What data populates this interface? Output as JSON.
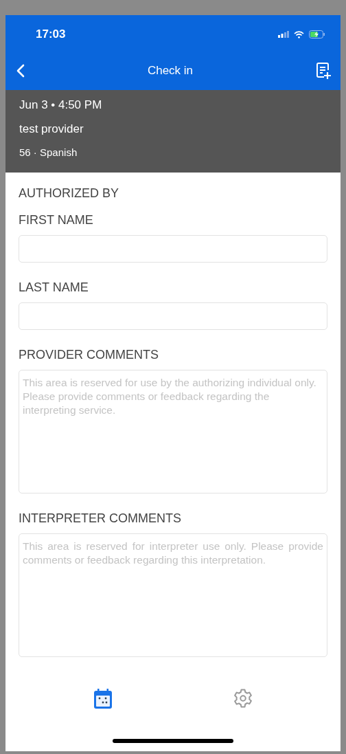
{
  "status_bar": {
    "time": "17:03"
  },
  "nav": {
    "title": "Check in"
  },
  "appointment": {
    "datetime": "Jun 3 • 4:50 PM",
    "provider": "test provider",
    "details": "56 · Spanish"
  },
  "form": {
    "section": "AUTHORIZED BY",
    "fields": [
      {
        "kind": "text",
        "label": "FIRST NAME"
      },
      {
        "kind": "text",
        "label": "LAST NAME"
      },
      {
        "kind": "textarea",
        "label": "PROVIDER COMMENTS",
        "placeholder": "This area is reserved for use by the authorizing individual only. Please provide comments or feedback regarding the interpreting service."
      },
      {
        "kind": "textarea",
        "label": "INTERPRETER COMMENTS",
        "placeholder": "This area is reserved for interpreter use only. Please provide comments or feedback regarding this interpretation.",
        "justified": true
      }
    ]
  },
  "tabs": [
    {
      "kind": "calendar",
      "selected": true
    },
    {
      "kind": "settings",
      "selected": false
    }
  ]
}
